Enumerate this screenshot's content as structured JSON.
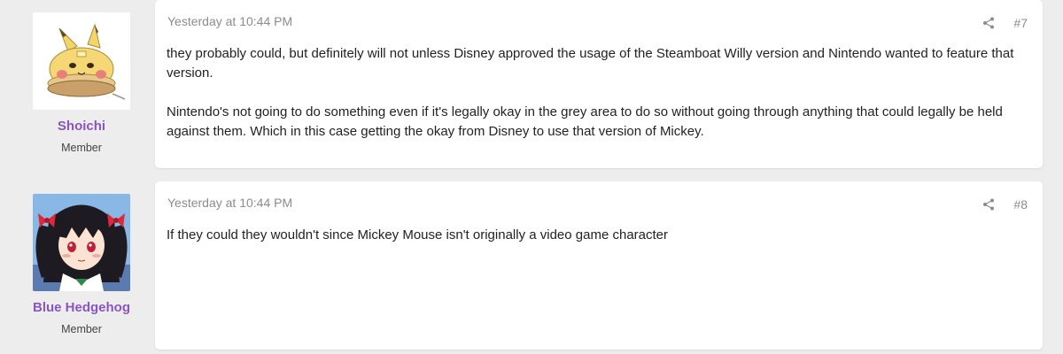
{
  "posts": [
    {
      "date": "Yesterday at 10:44 PM",
      "number": "#7",
      "username": "Shoichi",
      "user_title": "Member",
      "paragraphs": [
        "they probably could, but definitely will not unless Disney approved the usage of the Steamboat Willy version and Nintendo wanted to feature that version.",
        "Nintendo's not going to do something even if it's legally okay in the grey area to do so without going through anything that could legally be held against them. Which in this case getting the okay from Disney to use that version of Mickey."
      ]
    },
    {
      "date": "Yesterday at 10:44 PM",
      "number": "#8",
      "username": "Blue Hedgehog",
      "user_title": "Member",
      "paragraphs": [
        "If they could they wouldn't since Mickey Mouse isn't originally a video game character"
      ]
    }
  ],
  "colors": {
    "username": "#8a55c0",
    "meta_gray": "#8c8c8c",
    "page_bg": "#ededed"
  },
  "icons": [
    "pikachu-pancake-avatar",
    "anime-girl-avatar",
    "share-icon"
  ]
}
